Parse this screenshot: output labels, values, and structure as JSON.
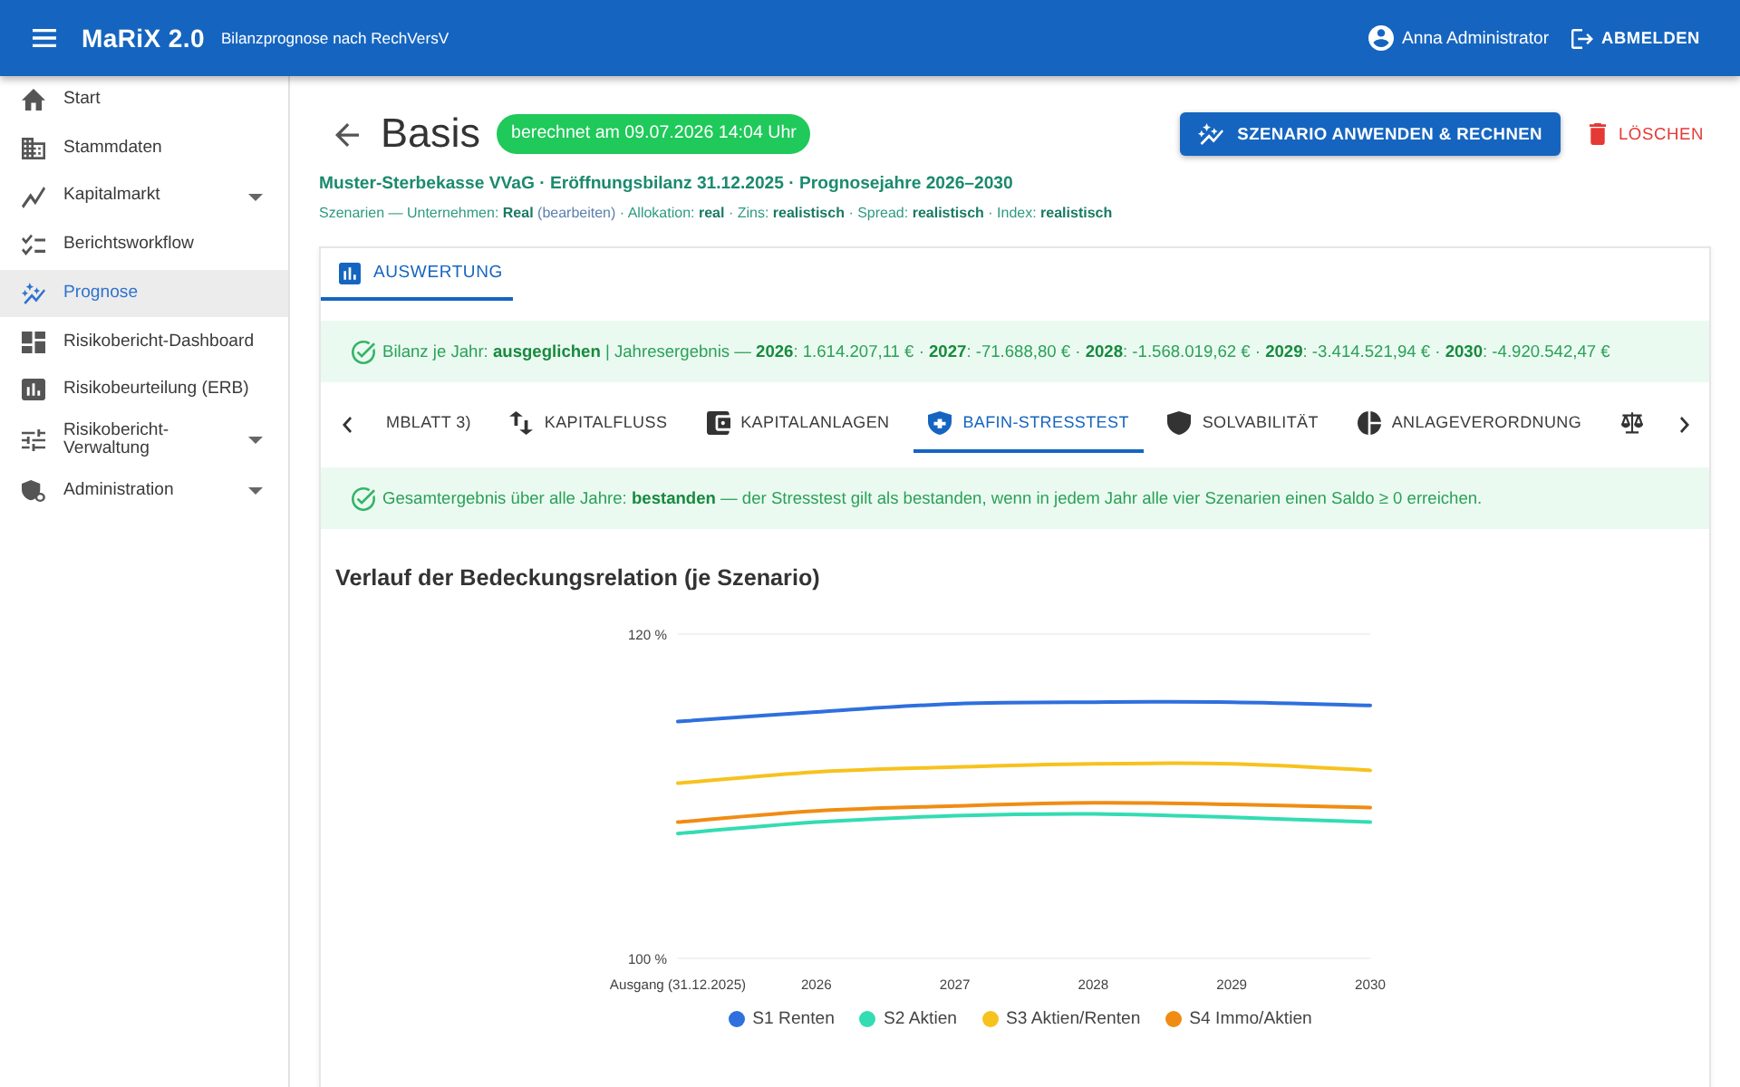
{
  "app_bar": {
    "title": "MaRiX 2.0",
    "subtitle": "Bilanzprognose nach RechVersV",
    "user": "Anna Administrator",
    "logout": "ABMELDEN"
  },
  "sidebar": {
    "items": [
      {
        "label": "Start",
        "kind": "link",
        "selected": false
      },
      {
        "label": "Stammdaten",
        "kind": "link",
        "selected": false
      },
      {
        "label": "Kapitalmarkt",
        "kind": "group",
        "selected": false
      },
      {
        "label": "Berichtsworkflow",
        "kind": "link",
        "selected": false
      },
      {
        "label": "Prognose",
        "kind": "link",
        "selected": true
      },
      {
        "label": "Risikobericht-Dashboard",
        "kind": "link",
        "selected": false
      },
      {
        "label": "Risikobeurteilung (ERB)",
        "kind": "link",
        "selected": false
      },
      {
        "label": "Risikobericht-Verwaltung",
        "kind": "group",
        "selected": false
      },
      {
        "label": "Administration",
        "kind": "group",
        "selected": false
      }
    ]
  },
  "header": {
    "title": "Basis",
    "status": "berechnet am 09.07.2026 14:04 Uhr",
    "actions": [
      {
        "kind": "primary",
        "label": "SZENARIO ANWENDEN & RECHNEN"
      },
      {
        "kind": "danger",
        "label": "LÖSCHEN"
      }
    ],
    "subtitle": "Muster-Sterbekasse VVaG · Eröffnungsbilanz 31.12.2025 · Prognosejahre 2026–2030",
    "scenarios": {
      "before": "Szenarien — Unternehmen: **Real** ",
      "link": "(bearbeiten)",
      "after": " · Allokation: **real** · Zins: **realistisch** · Spread: **realistisch** · Index: **realistisch**"
    }
  },
  "result_tabs": [
    {
      "label": "AUSWERTUNG",
      "selected": true
    }
  ],
  "balance_alert": {
    "text": "Bilanz je Jahr: **ausgeglichen** | Jahresergebnis — **2026**: 1.614.207,11 € · **2027**: -71.688,80 € · **2028**: -1.568.019,62 € · **2029**: -3.414.521,94 € · **2030**: -4.920.542,47 €"
  },
  "section_tabs": [
    {
      "label": "MBLATT 3)",
      "selected": false
    },
    {
      "label": "KAPITALFLUSS",
      "selected": false
    },
    {
      "label": "KAPITALANLAGEN",
      "selected": false
    },
    {
      "label": "BAFIN-STRESSTEST",
      "selected": true
    },
    {
      "label": "SOLVABILITÄT",
      "selected": false
    },
    {
      "label": "ANLAGEVERORDNUNG",
      "selected": false
    },
    {
      "selected": false
    }
  ],
  "stress_alert": {
    "text": "Gesamtergebnis über alle Jahre: **bestanden** — der Stresstest gilt als bestanden, wenn in jedem Jahr alle vier Szenarien einen Saldo ≥ 0 erreichen."
  },
  "coverage_chart": {
    "chart_data": {
      "type": "line",
      "title": "Verlauf der Bedeckungsrelation (je Szenario)",
      "categories": [
        "Ausgang (31.12.2025)",
        "2026",
        "2027",
        "2028",
        "2029",
        "2030"
      ],
      "series": [
        {
          "name": "S1 Renten",
          "color": "#2f6fde",
          "values": [
            114.6,
            115.2,
            115.7,
            115.8,
            115.8,
            115.6
          ]
        },
        {
          "name": "S2 Aktien",
          "color": "#33dcb2",
          "values": [
            107.7,
            108.4,
            108.8,
            108.9,
            108.7,
            108.4
          ]
        },
        {
          "name": "S3 Aktien/Renten",
          "color": "#f7c21e",
          "values": [
            110.8,
            111.5,
            111.8,
            112.0,
            112.0,
            111.6
          ]
        },
        {
          "name": "S4 Immo/Aktien",
          "color": "#f08c14",
          "values": [
            108.4,
            109.1,
            109.4,
            109.6,
            109.5,
            109.3
          ]
        }
      ],
      "ylim": [
        100,
        120
      ],
      "yticks": [
        {
          "value": 100,
          "label": "100 %"
        },
        {
          "value": 120,
          "label": "120 %"
        }
      ]
    }
  }
}
